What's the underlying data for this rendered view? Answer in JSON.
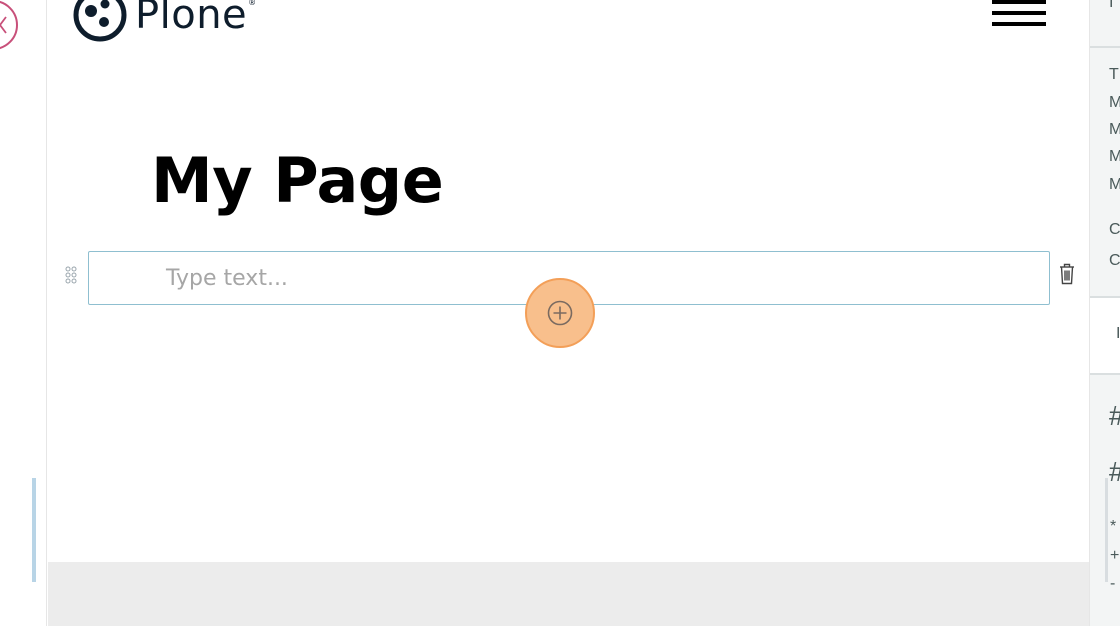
{
  "logo": {
    "text": "Plone",
    "reg_mark": "®"
  },
  "page": {
    "title": "My Page"
  },
  "editor": {
    "text_block_placeholder": "Type text..."
  },
  "sidebar": {
    "top_char": "I",
    "chars": [
      "T",
      "M",
      "M",
      "M",
      "M",
      "C",
      "C"
    ],
    "panel_char": "I",
    "hash_chars": [
      "#",
      "#"
    ],
    "small_chars": [
      "*",
      "+",
      "-"
    ]
  },
  "colors": {
    "close_ring": "#c8507a",
    "focus_border": "#8fbfd0",
    "add_ring_fill": "#f8bf8c",
    "add_ring_border": "#f39f58",
    "footer_band": "#ececec"
  }
}
